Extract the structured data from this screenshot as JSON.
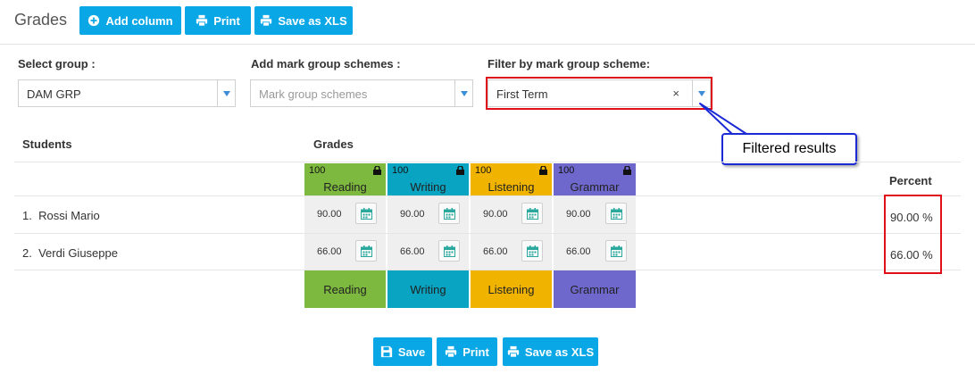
{
  "header": {
    "title": "Grades",
    "buttons": {
      "add_column": "Add column",
      "print": "Print",
      "save_xls": "Save as XLS"
    }
  },
  "filters": {
    "group": {
      "label": "Select group :",
      "value": "DAM GRP"
    },
    "mark_group": {
      "label": "Add mark group schemes :",
      "placeholder": "Mark group schemes"
    },
    "filter_scheme": {
      "label": "Filter by mark group scheme:",
      "value": "First Term",
      "clear": "×"
    }
  },
  "callout": {
    "text": "Filtered results"
  },
  "table": {
    "students_header": "Students",
    "grades_header": "Grades",
    "percent_header": "Percent",
    "columns": [
      {
        "name": "Reading",
        "max": "100",
        "color": "#7db93f"
      },
      {
        "name": "Writing",
        "max": "100",
        "color": "#08a4c1"
      },
      {
        "name": "Listening",
        "max": "100",
        "color": "#f0b400"
      },
      {
        "name": "Grammar",
        "max": "100",
        "color": "#6f68cc"
      }
    ],
    "rows": [
      {
        "index": "1.",
        "name": "Rossi Mario",
        "grades": [
          "90.00",
          "90.00",
          "90.00",
          "90.00"
        ],
        "percent": "90.00 %"
      },
      {
        "index": "2.",
        "name": "Verdi Giuseppe",
        "grades": [
          "66.00",
          "66.00",
          "66.00",
          "66.00"
        ],
        "percent": "66.00 %"
      }
    ]
  },
  "footer": {
    "save": "Save",
    "print": "Print",
    "save_xls": "Save as XLS"
  },
  "icons": {
    "add": "plus-circle-icon",
    "print": "printer-icon",
    "save": "floppy-disk-icon",
    "lock": "lock-icon",
    "calendar": "calendar-icon"
  }
}
